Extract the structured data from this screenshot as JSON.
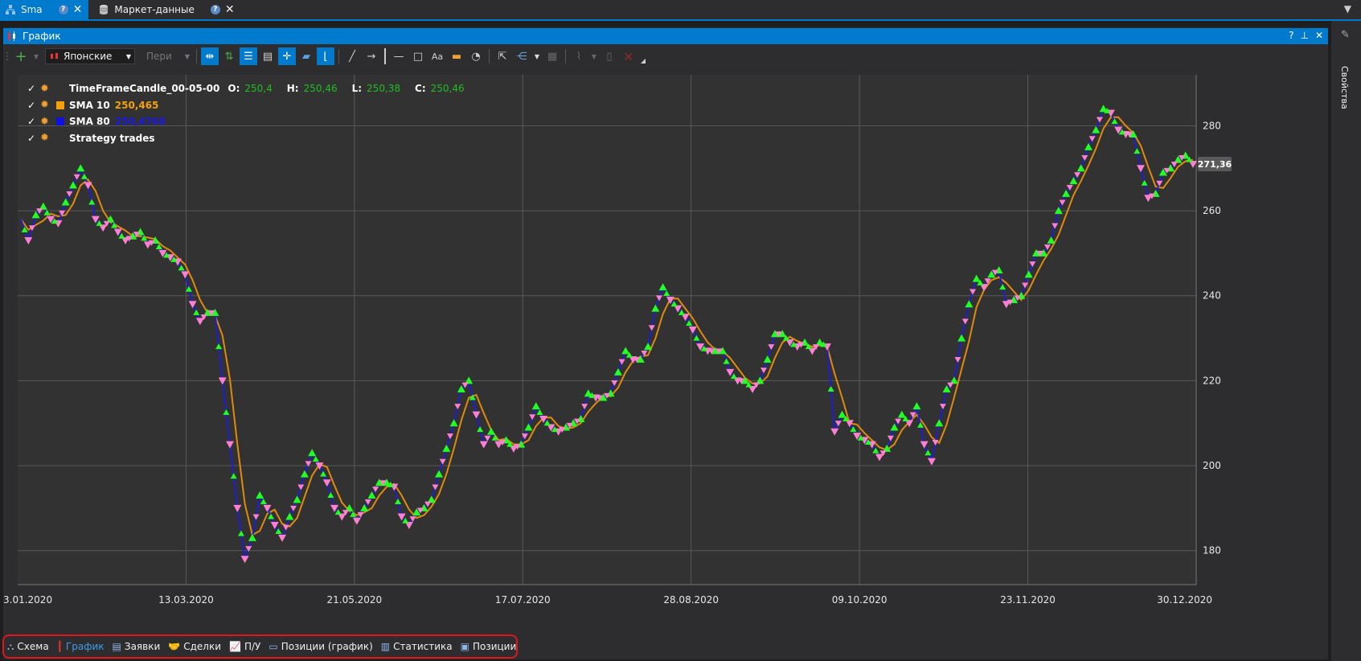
{
  "doc_tabs": [
    {
      "label": "Sma",
      "active": true,
      "icon": "scheme-icon",
      "help": "?",
      "close": "✕"
    },
    {
      "label": "Маркет-данные",
      "active": false,
      "icon": "database-icon",
      "help": "?",
      "close": "✕"
    }
  ],
  "panel": {
    "title": "График",
    "buttons": {
      "help": "?",
      "pin": "📌",
      "close": "✕"
    }
  },
  "toolbar": {
    "add_label": "+",
    "chart_style": "Японские",
    "period_placeholder": "Пери"
  },
  "legend": [
    {
      "name": "TimeFrameCandle_00-05-00",
      "swatch": "",
      "value": "",
      "ohlc": [
        {
          "k": "O:",
          "v": "250,4"
        },
        {
          "k": "H:",
          "v": "250,46"
        },
        {
          "k": "L:",
          "v": "250,38"
        },
        {
          "k": "C:",
          "v": "250,46"
        }
      ]
    },
    {
      "name": "SMA 10",
      "swatch": "#f5a00a",
      "value": "250,465",
      "value_color": "#f5a00a",
      "ohlc": []
    },
    {
      "name": "SMA 80",
      "swatch": "#1010e0",
      "value": "250,4768",
      "value_color": "#1a1ae6",
      "ohlc": []
    },
    {
      "name": "Strategy trades",
      "swatch": "",
      "value": "",
      "ohlc": []
    }
  ],
  "chart_data": {
    "type": "line",
    "x_ticks": [
      "3.01.2020",
      "13.03.2020",
      "21.05.2020",
      "17.07.2020",
      "28.08.2020",
      "09.10.2020",
      "23.11.2020",
      "30.12.2020"
    ],
    "y_ticks": [
      180,
      200,
      220,
      240,
      260,
      280
    ],
    "ylim": [
      172,
      292
    ],
    "last_price_label": "271,36",
    "grid": true,
    "colors": {
      "background": "#323232",
      "grid": "#5a5a5a",
      "price": "#1e1ed2",
      "sma": "#e08a10",
      "buy": "#22ff22",
      "sell": "#ff7fd1"
    },
    "series": [
      {
        "name": "price",
        "values": [
          258,
          253,
          259,
          261,
          258,
          257,
          262,
          266,
          270,
          266,
          258,
          256,
          258,
          255,
          253,
          254,
          255,
          252,
          253,
          250,
          249,
          248,
          245,
          238,
          234,
          236,
          236,
          220,
          205,
          190,
          178,
          183,
          193,
          190,
          186,
          183,
          188,
          192,
          198,
          203,
          200,
          196,
          190,
          188,
          190,
          187,
          190,
          193,
          196,
          196,
          195,
          188,
          186,
          189,
          190,
          192,
          198,
          204,
          210,
          218,
          220,
          212,
          205,
          208,
          205,
          206,
          204,
          205,
          209,
          214,
          211,
          209,
          208,
          209,
          210,
          211,
          217,
          216,
          216,
          217,
          222,
          227,
          225,
          225,
          228,
          237,
          242,
          239,
          237,
          235,
          232,
          228,
          227,
          227,
          227,
          222,
          220,
          220,
          218,
          220,
          225,
          231,
          231,
          229,
          228,
          229,
          227,
          229,
          228,
          208,
          212,
          210,
          207,
          206,
          205,
          202,
          204,
          209,
          212,
          210,
          214,
          205,
          201,
          210,
          218,
          220,
          230,
          238,
          244,
          242,
          245,
          246,
          238,
          239,
          240,
          245,
          250,
          250,
          253,
          260,
          264,
          267,
          270,
          275,
          279,
          284,
          283,
          279,
          278,
          278,
          270,
          263,
          264,
          269,
          270,
          272,
          273,
          271
        ]
      }
    ]
  },
  "bottom_tabs": [
    {
      "label": "Схема",
      "icon": "scheme-icon",
      "active": false
    },
    {
      "label": "График",
      "icon": "candles-icon",
      "active": true
    },
    {
      "label": "Заявки",
      "icon": "orders-icon",
      "active": false
    },
    {
      "label": "Сделки",
      "icon": "handshake-icon",
      "active": false
    },
    {
      "label": "П/У",
      "icon": "pnl-icon",
      "active": false
    },
    {
      "label": "Позиции (график)",
      "icon": "positions-chart-icon",
      "active": false
    },
    {
      "label": "Статистика",
      "icon": "statistics-icon",
      "active": false
    },
    {
      "label": "Позиции",
      "icon": "positions-icon",
      "active": false
    }
  ],
  "side_panel": {
    "label": "Свойства"
  }
}
